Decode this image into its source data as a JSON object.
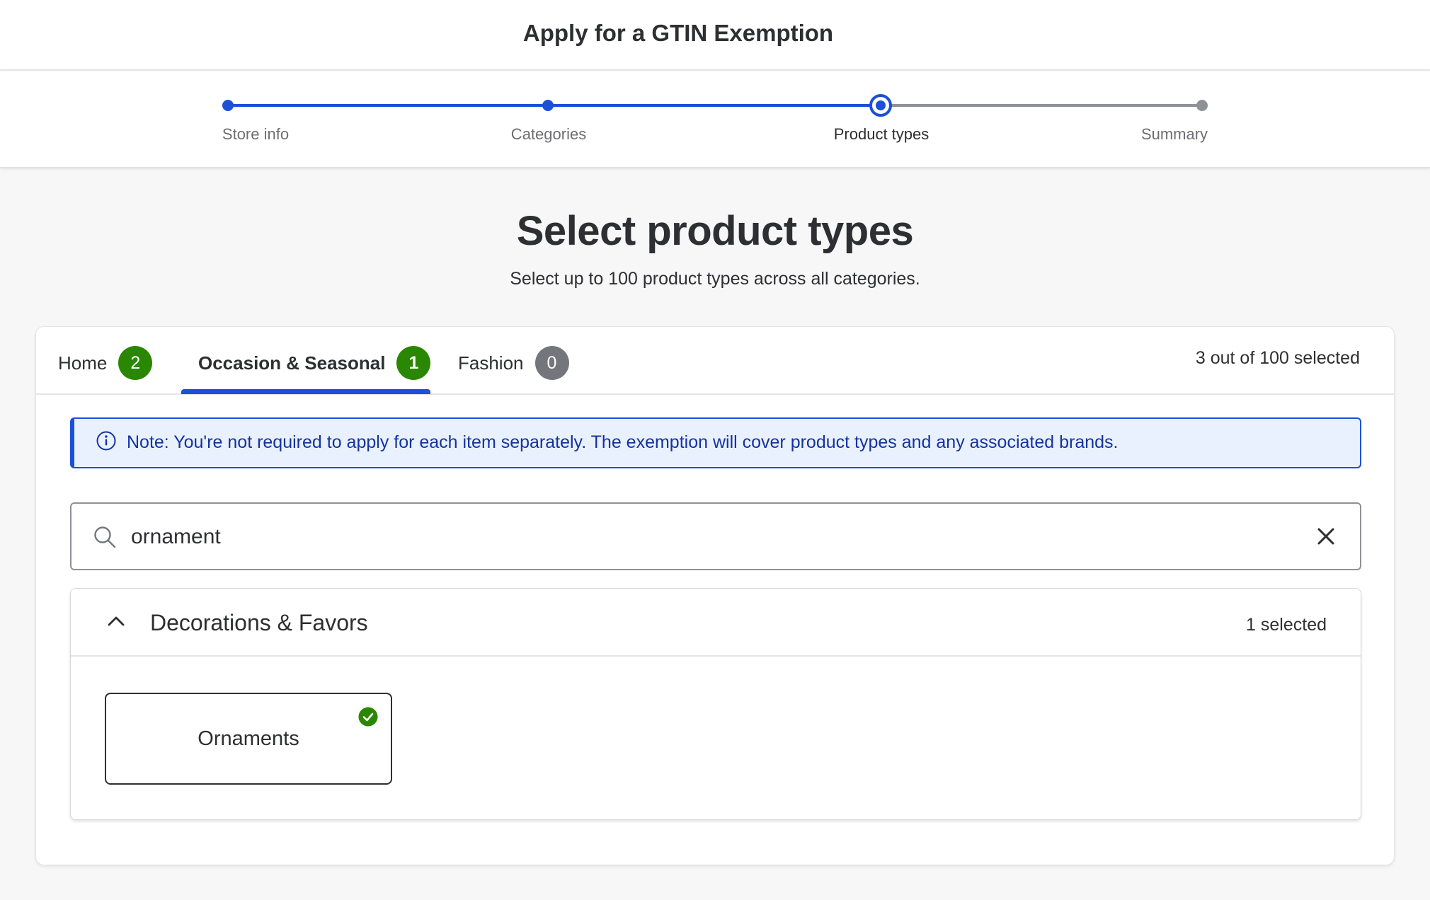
{
  "header": {
    "title": "Apply for a GTIN Exemption"
  },
  "stepper": {
    "steps": [
      {
        "label": "Store info",
        "status": "done"
      },
      {
        "label": "Categories",
        "status": "done"
      },
      {
        "label": "Product types",
        "status": "current"
      },
      {
        "label": "Summary",
        "status": "todo"
      }
    ]
  },
  "main": {
    "title": "Select product types",
    "subtitle": "Select up to 100 product types across all categories."
  },
  "tabs": {
    "items": [
      {
        "label": "Home",
        "count": "2"
      },
      {
        "label": "Occasion & Seasonal",
        "count": "1"
      },
      {
        "label": "Fashion",
        "count": "0"
      }
    ],
    "active_index": 1,
    "selected_summary": "3 out of 100 selected"
  },
  "note": {
    "text": "Note: You're not required to apply for each item separately. The exemption will cover product types and any associated brands."
  },
  "search": {
    "value": "ornament",
    "icon": "search-icon"
  },
  "accordion": {
    "title": "Decorations & Favors",
    "selected_count": "1 selected",
    "expanded": true,
    "items": [
      {
        "label": "Ornaments",
        "selected": true
      }
    ]
  },
  "colors": {
    "accent": "#1d4fd8",
    "success": "#2a8703",
    "neutral_badge": "#74767c",
    "note_bg": "#e9f1fe",
    "note_text": "#1433a0"
  }
}
